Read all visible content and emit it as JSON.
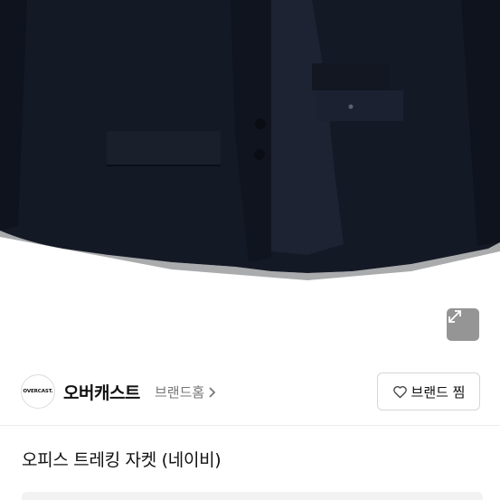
{
  "product": {
    "image_alt": "navy office trekking jacket",
    "expand_icon": "expand-arrows-icon",
    "title": "오피스 트레킹 자켓 (네이비)"
  },
  "brand": {
    "logo_text": "OVERCAST.",
    "name": "오버캐스트",
    "home_label": "브랜드홈",
    "like_label": "브랜드 찜",
    "like_icon": "heart-outline-icon"
  },
  "colors": {
    "jacket": "#151a26",
    "expand_bg": "#8a8a8a"
  }
}
